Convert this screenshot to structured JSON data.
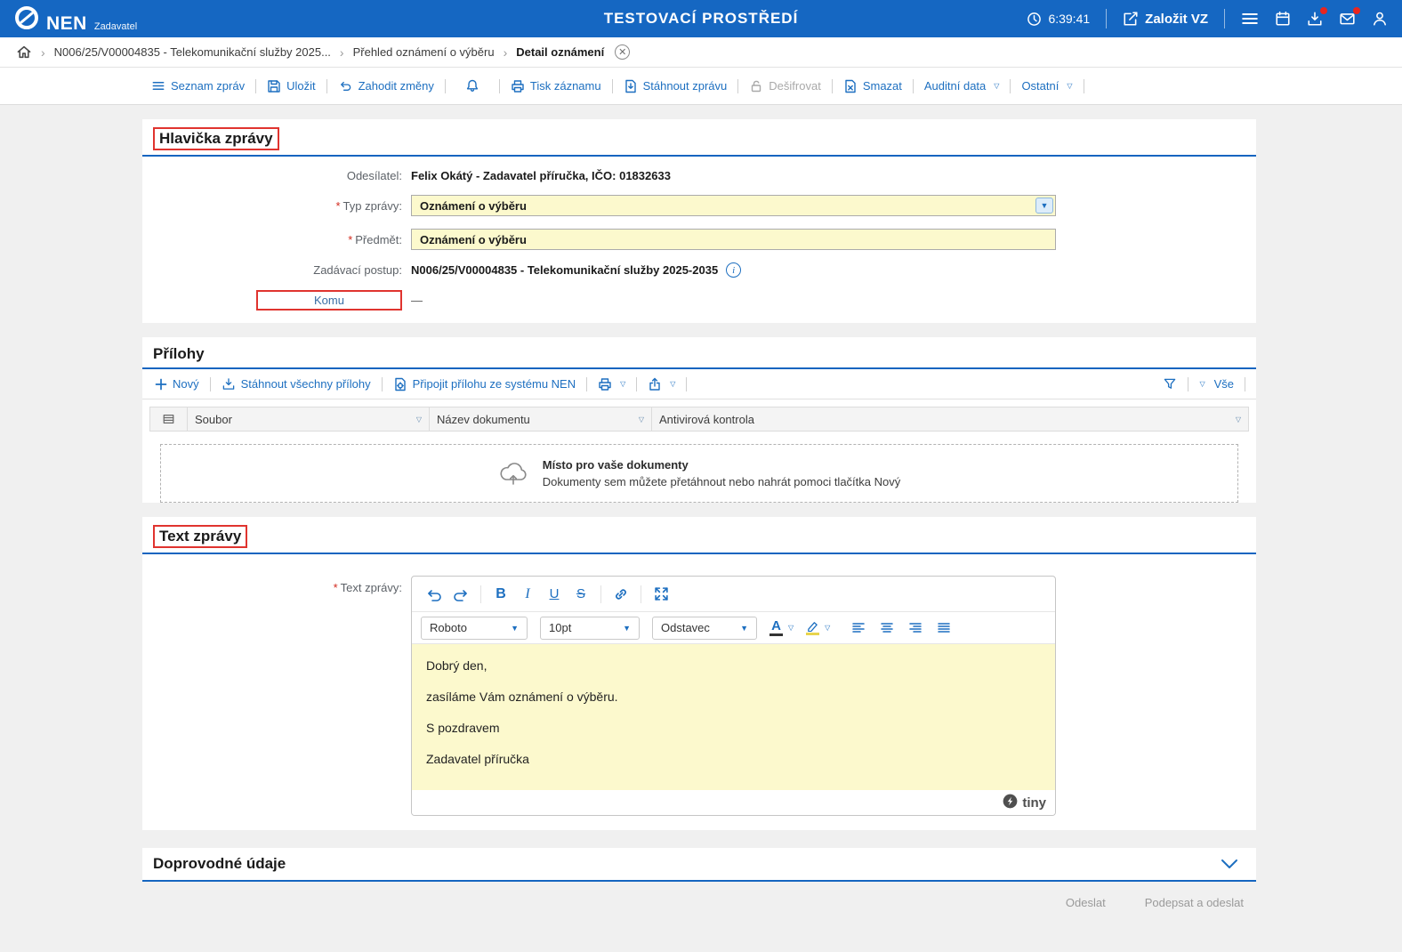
{
  "colors": {
    "header_bg": "#1567c2",
    "accent_blue": "#1d6fc0",
    "section_rule": "#1565c0",
    "input_yellow": "#fcf9cd",
    "annotation_red": "#e0342f",
    "badge_red": "#e8251f"
  },
  "ui": {
    "required_mark": "*"
  },
  "header": {
    "logo": "NEN",
    "logo_sub": "Zadavatel",
    "env_title": "TESTOVACÍ PROSTŘEDÍ",
    "time": "6:39:41",
    "new_vz": "Založit VZ"
  },
  "breadcrumb": {
    "item1": "N006/25/V00004835 - Telekomunikační služby 2025...",
    "item2": "Přehled oznámení o výběru",
    "item3": "Detail oznámení"
  },
  "toolbar": {
    "seznam": "Seznam zpráv",
    "ulozit": "Uložit",
    "zahodit": "Zahodit změny",
    "tisk": "Tisk záznamu",
    "stahnout": "Stáhnout zprávu",
    "desifrovat": "Dešifrovat",
    "smazat": "Smazat",
    "auditni": "Auditní data",
    "ostatni": "Ostatní"
  },
  "message_header": {
    "title": "Hlavička zprávy",
    "sender_label": "Odesílatel:",
    "sender_value": "Felix Okátý - Zadavatel příručka, IČO: 01832633",
    "type_label": "Typ zprávy:",
    "type_value": "Oznámení o výběru",
    "subject_label": "Předmět:",
    "subject_value": "Oznámení o výběru",
    "procedure_label": "Zadávací postup:",
    "procedure_value": "N006/25/V00004835 - Telekomunikační služby 2025-2035",
    "recipient_label": "Komu",
    "recipient_value": "—"
  },
  "attachments": {
    "title": "Přílohy",
    "new_label": "Nový",
    "download_all": "Stáhnout všechny přílohy",
    "attach_nen": "Připojit přílohu ze systému NEN",
    "all_filter": "Vše",
    "columns": {
      "file": "Soubor",
      "doc_name": "Název dokumentu",
      "antivirus": "Antivirová kontrola"
    },
    "empty_title": "Místo pro vaše dokumenty",
    "empty_hint": "Dokumenty sem můžete přetáhnout nebo nahrát pomoci tlačítka Nový"
  },
  "message_text": {
    "title": "Text zprávy",
    "label": "Text zprávy:",
    "font_name": "Roboto",
    "font_size": "10pt",
    "block_format": "Odstavec",
    "lines": {
      "0": "Dobrý den,",
      "1": "zasíláme Vám oznámení o výběru.",
      "2": "S pozdravem",
      "3": "Zadavatel příručka"
    },
    "brand": "tiny"
  },
  "extra_section": {
    "title": "Doprovodné údaje"
  },
  "footer": {
    "send": "Odeslat",
    "sign_send": "Podepsat a odeslat"
  }
}
